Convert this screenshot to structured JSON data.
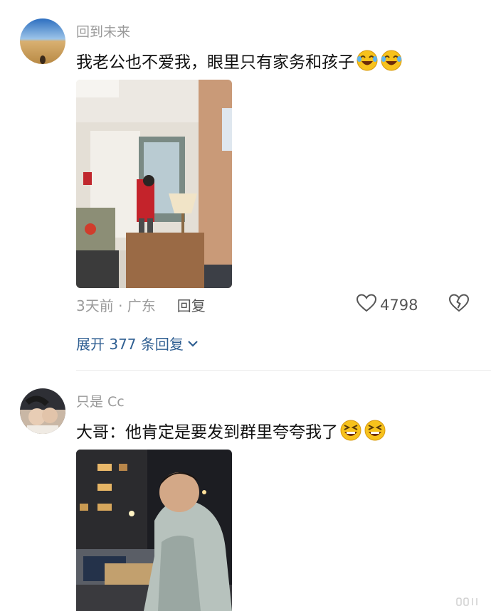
{
  "comments": [
    {
      "username": "回到未来",
      "text": "我老公也不爱我，眼里只有家务和孩子",
      "emojis": [
        "rolling-laughing-emoji",
        "rolling-laughing-emoji"
      ],
      "time_location": "3天前 · 广东",
      "reply_label": "回复",
      "likes": "4798",
      "expand_label": "展开 377 条回复"
    },
    {
      "username": "只是 Cc",
      "text": "大哥：他肯定是要发到群里夸夸我了",
      "emojis": [
        "grinning-squint-emoji",
        "grinning-squint-emoji"
      ]
    }
  ],
  "colors": {
    "username": "#9a9a9a",
    "link": "#2f5f92",
    "text": "#111111"
  }
}
